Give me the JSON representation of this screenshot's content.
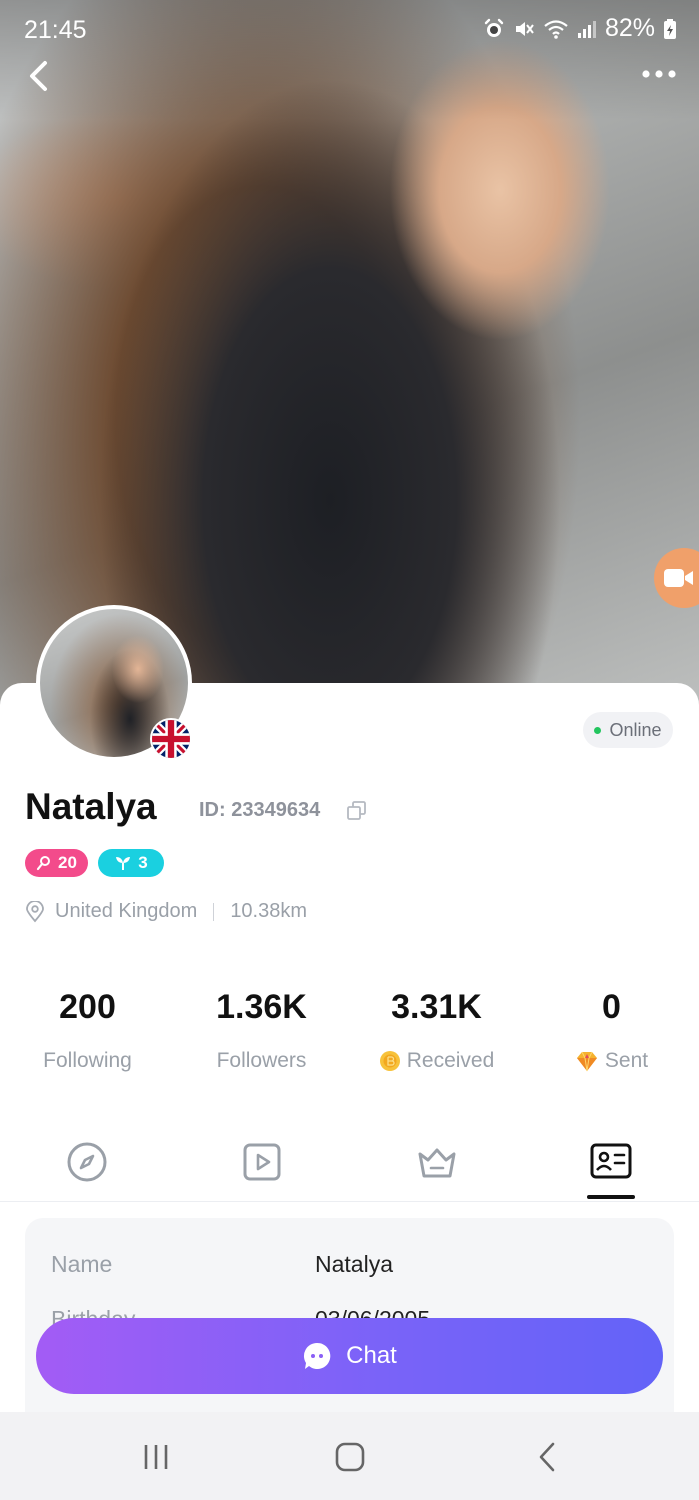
{
  "status_bar": {
    "time": "21:45",
    "battery": "82%"
  },
  "profile": {
    "name": "Natalya",
    "id_text": "ID: 23349634",
    "online_status": "Online",
    "country": "United Kingdom",
    "distance": "10.38km",
    "badges": [
      {
        "value": "20",
        "icon": "user-level-icon",
        "color": "#f34b8b"
      },
      {
        "value": "3",
        "icon": "sprout-icon",
        "color": "#1ad0e0"
      }
    ]
  },
  "stats": [
    {
      "value": "200",
      "label": "Following"
    },
    {
      "value": "1.36K",
      "label": "Followers"
    },
    {
      "value": "3.31K",
      "label": "Received"
    },
    {
      "value": "0",
      "label": "Sent"
    }
  ],
  "tabs": [
    "compass-icon",
    "video-icon",
    "crown-icon",
    "id-card-icon"
  ],
  "active_tab": "id-card-icon",
  "info": [
    {
      "key": "Name",
      "value": "Natalya"
    },
    {
      "key": "Birthday",
      "value": "03/06/2005"
    }
  ],
  "chat_button": "Chat",
  "colors": {
    "online": "#22c55e",
    "chat_gradient_start": "#a35cf5",
    "chat_gradient_end": "#6363f8"
  }
}
